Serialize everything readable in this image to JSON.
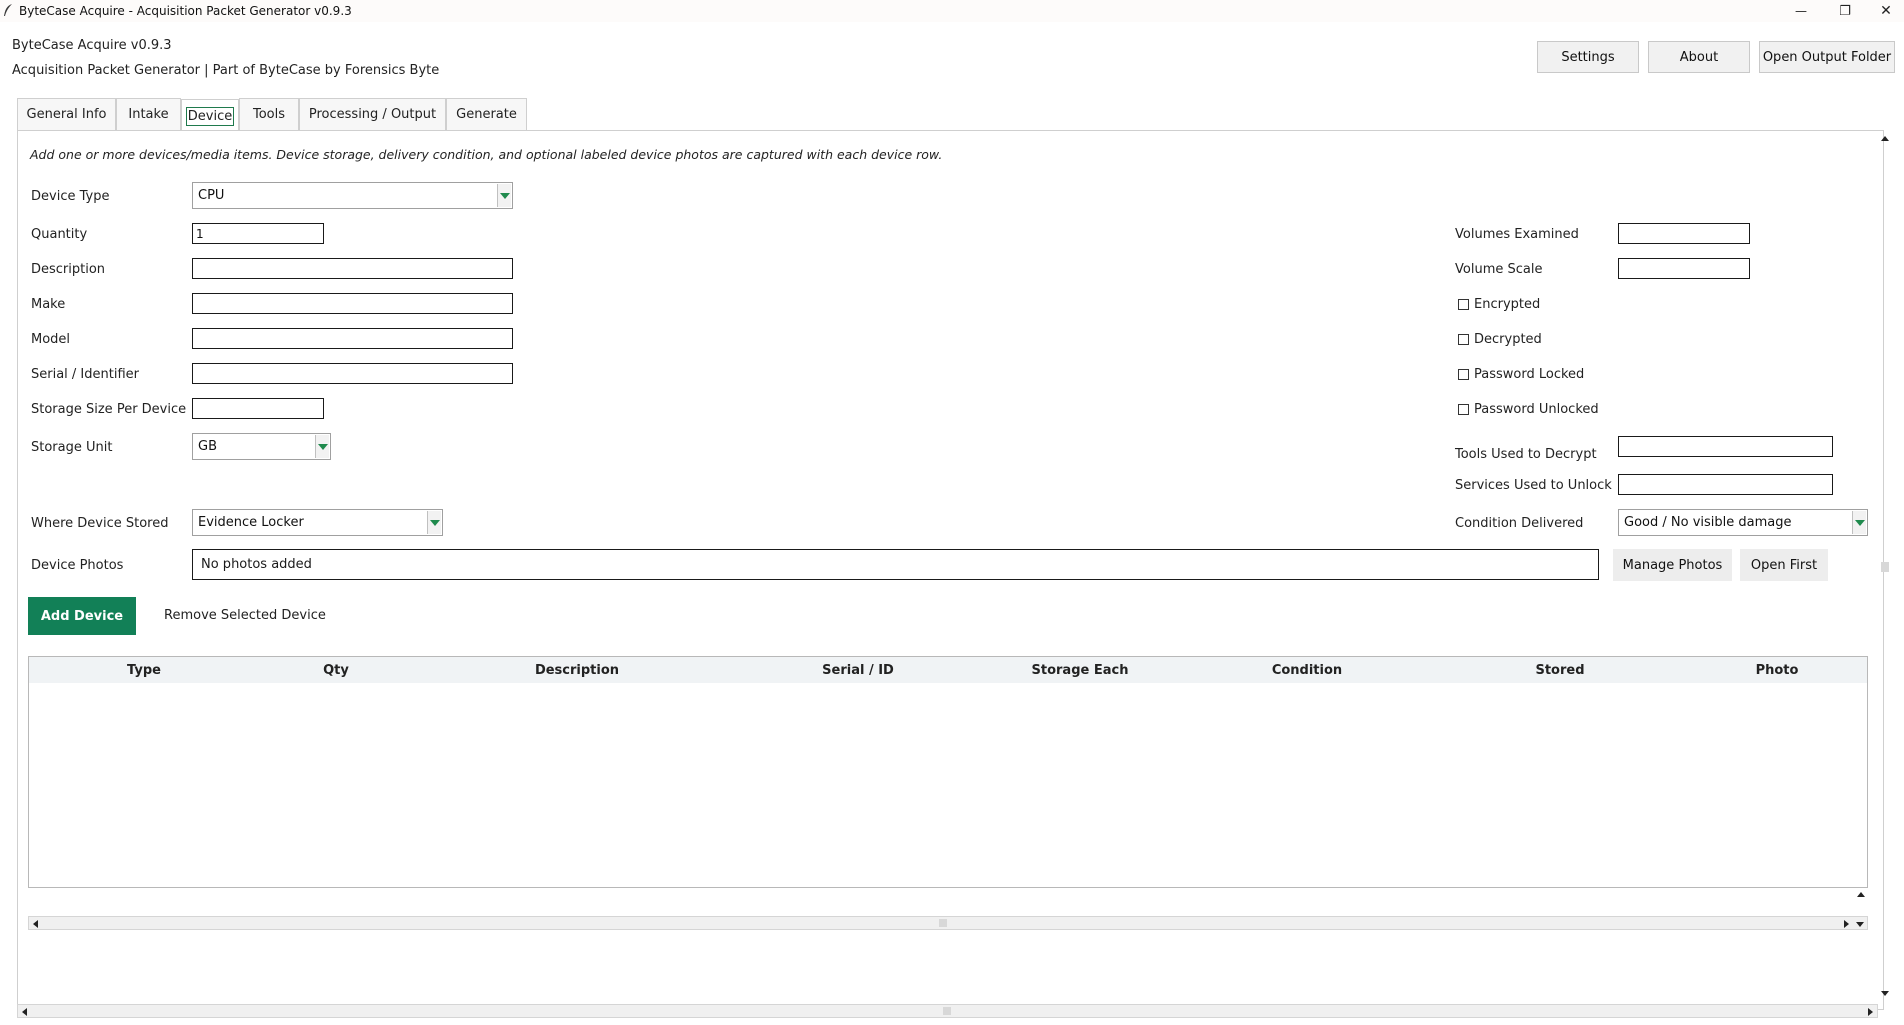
{
  "window": {
    "title": "ByteCase Acquire - Acquisition Packet Generator v0.9.3",
    "minimize_glyph": "—",
    "restore_glyph": "❐",
    "close_glyph": "✕"
  },
  "header": {
    "app_version": "ByteCase Acquire v0.9.3",
    "subtitle": "Acquisition Packet Generator | Part of ByteCase by Forensics Byte",
    "buttons": {
      "settings": "Settings",
      "about": "About",
      "open_output": "Open Output Folder"
    }
  },
  "tabs": [
    {
      "label": "General Info"
    },
    {
      "label": "Intake"
    },
    {
      "label": "Device",
      "active": true
    },
    {
      "label": "Tools"
    },
    {
      "label": "Processing / Output"
    },
    {
      "label": "Generate"
    }
  ],
  "device": {
    "intro": "Add one or more devices/media items. Device storage, delivery condition, and optional labeled device photos are captured with each device row.",
    "labels": {
      "device_type": "Device Type",
      "quantity": "Quantity",
      "description": "Description",
      "make": "Make",
      "model": "Model",
      "serial": "Serial / Identifier",
      "storage_size": "Storage Size Per Device",
      "storage_unit": "Storage Unit",
      "where_stored": "Where Device Stored",
      "photos": "Device Photos",
      "volumes_examined": "Volumes Examined",
      "volume_scale": "Volume Scale",
      "encrypted": "Encrypted",
      "decrypted": "Decrypted",
      "password_locked": "Password Locked",
      "password_unlocked": "Password Unlocked",
      "tools_decrypt": "Tools Used to Decrypt",
      "services_unlock": "Services Used to Unlock",
      "condition": "Condition Delivered"
    },
    "values": {
      "device_type": "CPU",
      "quantity": "1",
      "description": "",
      "make": "",
      "model": "",
      "serial": "",
      "storage_size": "",
      "storage_unit": "GB",
      "where_stored": "Evidence Locker",
      "photos": "No photos added",
      "volumes_examined": "",
      "volume_scale": "",
      "tools_decrypt": "",
      "services_unlock": "",
      "condition": "Good / No visible damage"
    },
    "checkboxes": {
      "encrypted": false,
      "decrypted": false,
      "password_locked": false,
      "password_unlocked": false
    },
    "buttons": {
      "manage_photos": "Manage Photos",
      "open_first": "Open First",
      "add_device": "Add Device",
      "remove_device": "Remove Selected Device"
    },
    "table": {
      "columns": [
        "Type",
        "Qty",
        "Description",
        "Serial / ID",
        "Storage Each",
        "Condition",
        "Stored",
        "Photo"
      ],
      "rows": []
    }
  },
  "colors": {
    "accent_green": "#128057",
    "combo_arrow": "#1f8a4d"
  }
}
